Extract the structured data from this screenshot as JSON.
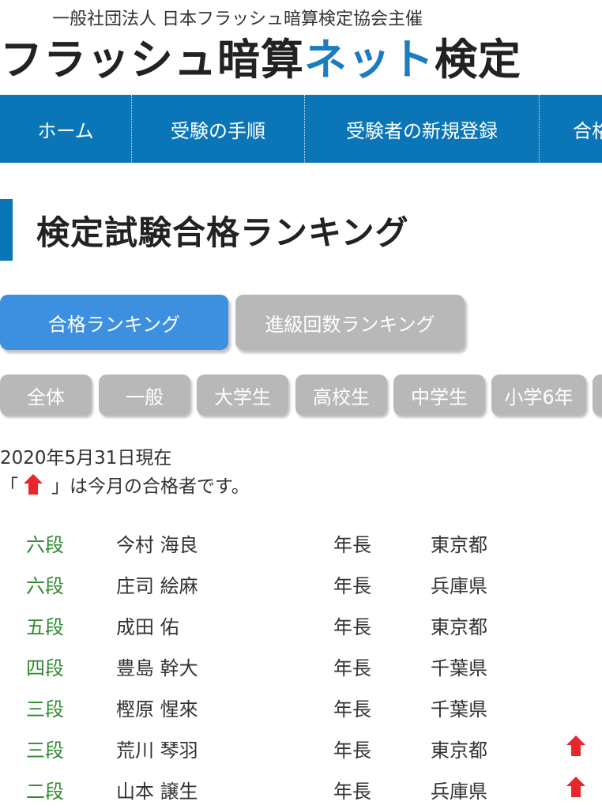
{
  "header": {
    "org_line": "一般社団法人 日本フラッシュ暗算検定協会主催",
    "brand_part1": "フラッシュ暗算",
    "brand_accent": "ネット",
    "brand_part3": "検定"
  },
  "nav": {
    "items": [
      {
        "label": "ホーム"
      },
      {
        "label": "受験の手順"
      },
      {
        "label": "受験者の新規登録"
      },
      {
        "label": "合格"
      }
    ]
  },
  "page_title": "検定試験合格ランキング",
  "tabs": [
    {
      "label": "合格ランキング",
      "active": true
    },
    {
      "label": "進級回数ランキング",
      "active": false
    }
  ],
  "filters": [
    {
      "label": "全体"
    },
    {
      "label": "一般"
    },
    {
      "label": "大学生"
    },
    {
      "label": "高校生"
    },
    {
      "label": "中学生"
    },
    {
      "label": "小学6年"
    },
    {
      "label": ""
    }
  ],
  "date_line": "2020年5月31日現在",
  "note": {
    "open_quote": "「",
    "text": "」は今月の合格者です。",
    "icon": "red-up-arrow-icon"
  },
  "colors": {
    "nav_bg": "#0a76b8",
    "brand_accent": "#1c7cbf",
    "active_tab": "#3d8fe0",
    "inactive_tab": "#b8b8b8",
    "rank_text": "#2f8a2f",
    "arrow": "#e8262c"
  },
  "rankings": [
    {
      "rank": "六段",
      "name": "今村 海良",
      "age": "年長",
      "pref": "東京都",
      "new": false
    },
    {
      "rank": "六段",
      "name": "庄司 絵麻",
      "age": "年長",
      "pref": "兵庫県",
      "new": false
    },
    {
      "rank": "五段",
      "name": "成田 佑",
      "age": "年長",
      "pref": "東京都",
      "new": false
    },
    {
      "rank": "四段",
      "name": "豊島 幹大",
      "age": "年長",
      "pref": "千葉県",
      "new": false
    },
    {
      "rank": "三段",
      "name": "樫原 惺來",
      "age": "年長",
      "pref": "千葉県",
      "new": false
    },
    {
      "rank": "三段",
      "name": "荒川 琴羽",
      "age": "年長",
      "pref": "東京都",
      "new": true
    },
    {
      "rank": "二段",
      "name": "山本 譲生",
      "age": "年長",
      "pref": "兵庫県",
      "new": true
    }
  ]
}
